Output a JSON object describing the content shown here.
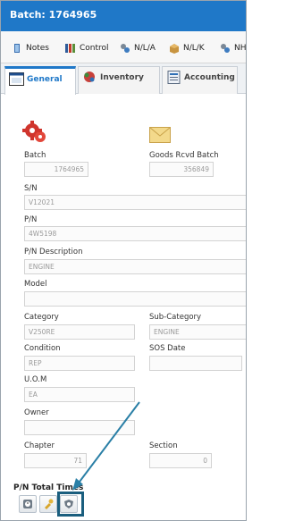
{
  "window": {
    "title": "Batch: 1764965"
  },
  "toolbar": {
    "items": [
      {
        "label": "Notes",
        "icon": "notes-icon"
      },
      {
        "label": "Control",
        "icon": "control-icon"
      },
      {
        "label": "N/L/A",
        "icon": "nla-icon"
      },
      {
        "label": "N/L/K",
        "icon": "nlk-icon"
      },
      {
        "label": "NH",
        "icon": "nh-icon"
      }
    ]
  },
  "tabs": [
    {
      "label": "General",
      "icon": "general-tab-icon",
      "active": true
    },
    {
      "label": "Inventory",
      "icon": "inventory-tab-icon",
      "active": false
    },
    {
      "label": "Accounting",
      "icon": "accounting-tab-icon",
      "active": false
    }
  ],
  "form": {
    "batch": {
      "label": "Batch",
      "value": "1764965"
    },
    "goods_rcvd_batch": {
      "label": "Goods Rcvd Batch",
      "value": "356849"
    },
    "sn": {
      "label": "S/N",
      "value": "V12021"
    },
    "pn": {
      "label": "P/N",
      "value": "4W5198"
    },
    "pn_description": {
      "label": "P/N Description",
      "value": "ENGINE"
    },
    "model": {
      "label": "Model",
      "value": ""
    },
    "category": {
      "label": "Category",
      "value": "V250RE"
    },
    "sub_category": {
      "label": "Sub-Category",
      "value": "ENGINE"
    },
    "condition": {
      "label": "Condition",
      "value": "REP"
    },
    "sos_date": {
      "label": "SOS Date",
      "value": ""
    },
    "uom": {
      "label": "U.O.M",
      "value": "EA"
    },
    "owner": {
      "label": "Owner",
      "value": ""
    },
    "chapter": {
      "label": "Chapter",
      "value": "71"
    },
    "section": {
      "label": "Section",
      "value": "0"
    }
  },
  "pn_total_times": {
    "title": "P/N Total Times",
    "buttons": [
      "clock-icon",
      "wrench-icon",
      "shield-icon"
    ]
  },
  "colors": {
    "title_bar": "#1f78c8",
    "highlight": "#1a5e7e",
    "arrow": "#2a7fa6"
  }
}
